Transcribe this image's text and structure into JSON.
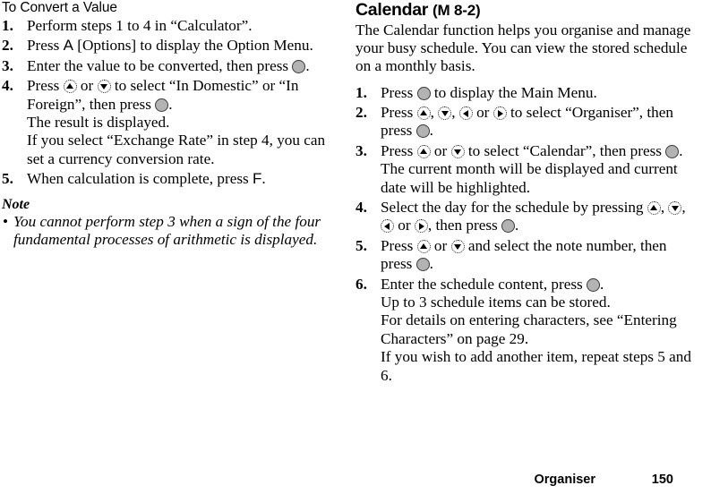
{
  "left_column": {
    "heading": "To Convert a Value",
    "steps": [
      {
        "number": "1.",
        "parts": [
          {
            "type": "text",
            "value": "Perform steps 1 to 4 in “Calculator”."
          }
        ]
      },
      {
        "number": "2.",
        "parts": [
          {
            "type": "text",
            "value": "Press "
          },
          {
            "type": "softkey",
            "value": "A"
          },
          {
            "type": "text",
            "value": " [Options] to display the Option Menu."
          }
        ]
      },
      {
        "number": "3.",
        "parts": [
          {
            "type": "text",
            "value": "Enter the value to be converted, then press "
          },
          {
            "type": "key",
            "value": "center-key"
          },
          {
            "type": "text",
            "value": "."
          }
        ]
      },
      {
        "number": "4.",
        "parts": [
          {
            "type": "text",
            "value": "Press "
          },
          {
            "type": "key",
            "value": "up-key"
          },
          {
            "type": "text",
            "value": " or "
          },
          {
            "type": "key",
            "value": "down-key"
          },
          {
            "type": "text",
            "value": " to select “In Domestic” or “In Foreign”, then press "
          },
          {
            "type": "key",
            "value": "center-key"
          },
          {
            "type": "text",
            "value": "."
          }
        ],
        "sub_paragraphs": [
          "The result is displayed.",
          "If you select “Exchange Rate” in step 4, you can set a currency conversion rate."
        ]
      },
      {
        "number": "5.",
        "parts": [
          {
            "type": "text",
            "value": "When calculation is complete, press "
          },
          {
            "type": "softkey",
            "value": "F"
          },
          {
            "type": "text",
            "value": "."
          }
        ]
      }
    ],
    "note": {
      "heading": "Note",
      "bullet": "•",
      "items": [
        "You cannot perform step 3 when a sign of the four fundamental processes of arithmetic is displayed."
      ]
    }
  },
  "right_column": {
    "heading": "Calendar",
    "heading_ref": "(M 8-2)",
    "intro": "The Calendar function helps you organise and manage your busy schedule. You can view the stored schedule on a monthly basis.",
    "steps": [
      {
        "number": "1.",
        "parts": [
          {
            "type": "text",
            "value": "Press "
          },
          {
            "type": "key",
            "value": "center-key"
          },
          {
            "type": "text",
            "value": " to display the Main Menu."
          }
        ]
      },
      {
        "number": "2.",
        "parts": [
          {
            "type": "text",
            "value": "Press "
          },
          {
            "type": "key",
            "value": "up-key"
          },
          {
            "type": "text",
            "value": ", "
          },
          {
            "type": "key",
            "value": "down-key"
          },
          {
            "type": "text",
            "value": ", "
          },
          {
            "type": "key",
            "value": "left-key"
          },
          {
            "type": "text",
            "value": " or "
          },
          {
            "type": "key",
            "value": "right-key"
          },
          {
            "type": "text",
            "value": " to select “Organiser”, then press "
          },
          {
            "type": "key",
            "value": "center-key"
          },
          {
            "type": "text",
            "value": "."
          }
        ]
      },
      {
        "number": "3.",
        "parts": [
          {
            "type": "text",
            "value": "Press "
          },
          {
            "type": "key",
            "value": "up-key"
          },
          {
            "type": "text",
            "value": " or "
          },
          {
            "type": "key",
            "value": "down-key"
          },
          {
            "type": "text",
            "value": " to select “Calendar”, then press "
          },
          {
            "type": "key",
            "value": "center-key"
          },
          {
            "type": "text",
            "value": "."
          }
        ],
        "sub_paragraphs": [
          "The current month will be displayed and current date will be highlighted."
        ]
      },
      {
        "number": "4.",
        "parts": [
          {
            "type": "text",
            "value": "Select the day for the schedule by pressing "
          },
          {
            "type": "key",
            "value": "up-key"
          },
          {
            "type": "text",
            "value": ", "
          },
          {
            "type": "key",
            "value": "down-key"
          },
          {
            "type": "text",
            "value": ", "
          },
          {
            "type": "key",
            "value": "left-key"
          },
          {
            "type": "text",
            "value": " or "
          },
          {
            "type": "key",
            "value": "right-key"
          },
          {
            "type": "text",
            "value": ", then press "
          },
          {
            "type": "key",
            "value": "center-key"
          },
          {
            "type": "text",
            "value": "."
          }
        ]
      },
      {
        "number": "5.",
        "parts": [
          {
            "type": "text",
            "value": "Press "
          },
          {
            "type": "key",
            "value": "up-key"
          },
          {
            "type": "text",
            "value": " or "
          },
          {
            "type": "key",
            "value": "down-key"
          },
          {
            "type": "text",
            "value": " and select the note number, then press "
          },
          {
            "type": "key",
            "value": "center-key"
          },
          {
            "type": "text",
            "value": "."
          }
        ]
      },
      {
        "number": "6.",
        "parts": [
          {
            "type": "text",
            "value": "Enter the schedule content, press "
          },
          {
            "type": "key",
            "value": "center-key"
          },
          {
            "type": "text",
            "value": "."
          }
        ],
        "sub_paragraphs": [
          "Up to 3 schedule items can be stored.",
          "For details on entering characters, see “Entering Characters” on page 29.",
          "If you wish to add another item, repeat steps 5 and 6."
        ]
      }
    ]
  },
  "footer": {
    "section": "Organiser",
    "page_number": "150"
  },
  "colors": {
    "text": "#000000",
    "background": "#ffffff",
    "key_fill": "#b3b3b3",
    "key_stroke": "#3a3a3a"
  }
}
